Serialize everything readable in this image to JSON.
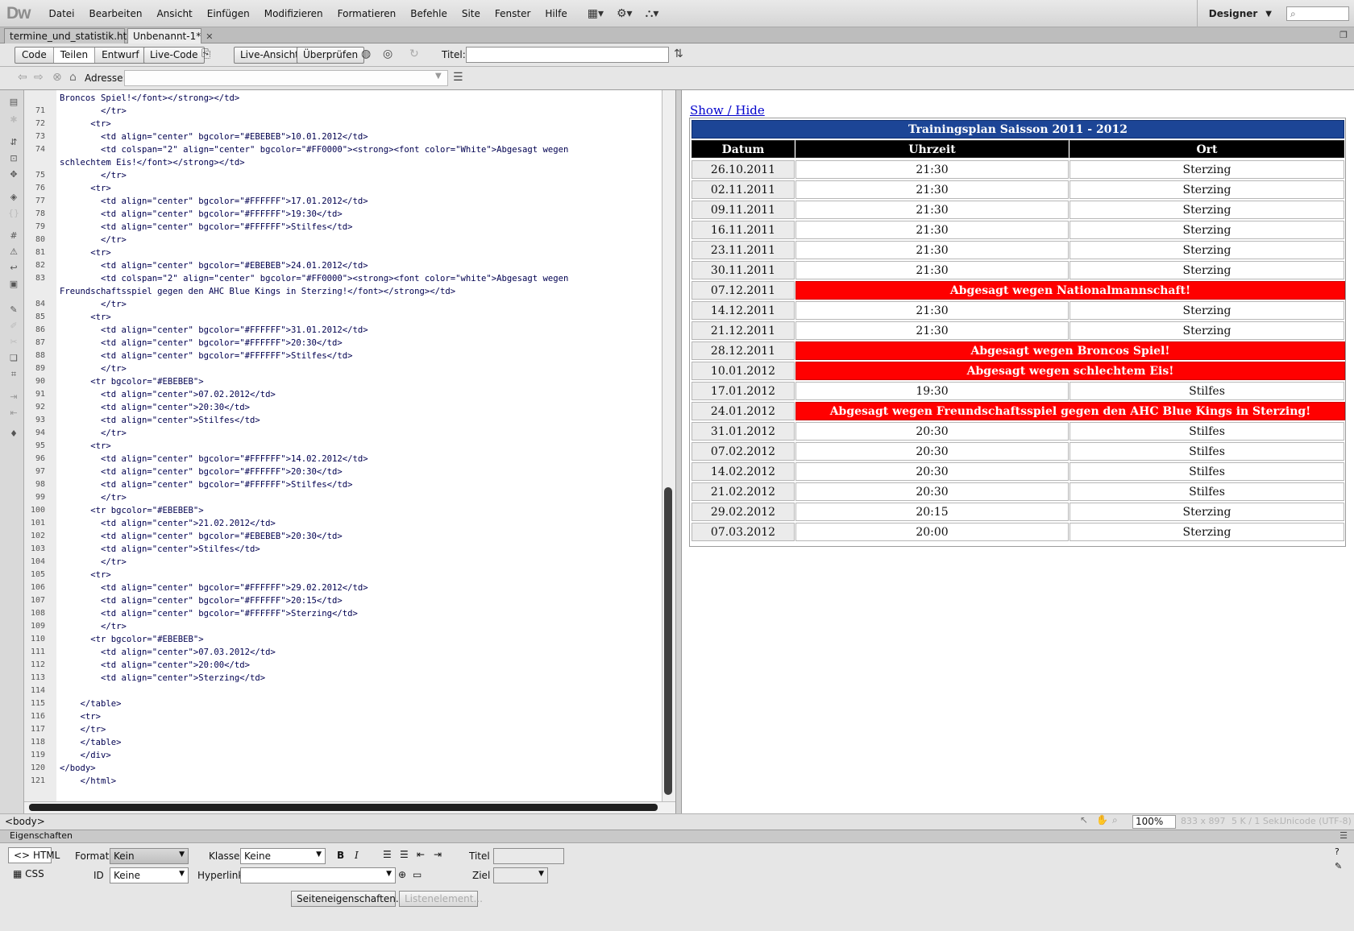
{
  "app": {
    "logo": "Dw",
    "menu": [
      "Datei",
      "Bearbeiten",
      "Ansicht",
      "Einfügen",
      "Modifizieren",
      "Formatieren",
      "Befehle",
      "Site",
      "Fenster",
      "Hilfe"
    ],
    "workspace": "Designer"
  },
  "tabs": [
    {
      "label": "termine_und_statistik.htm",
      "active": false
    },
    {
      "label": "Unbenannt-1*",
      "active": true
    }
  ],
  "toolbar": {
    "code": "Code",
    "split": "Teilen",
    "design": "Entwurf",
    "live_code": "Live-Code",
    "live_view": "Live-Ansicht",
    "check": "Überprüfen",
    "title_label": "Titel:",
    "title_value": ""
  },
  "address": {
    "label": "Adresse:",
    "value": ""
  },
  "code": {
    "lines": [
      {
        "num": "",
        "text": "Broncos Spiel!</font></strong></td>"
      },
      {
        "num": "71",
        "text": "        </tr>"
      },
      {
        "num": "72",
        "text": "      <tr>"
      },
      {
        "num": "73",
        "text": "        <td align=\"center\" bgcolor=\"#EBEBEB\">10.01.2012</td>"
      },
      {
        "num": "74",
        "text": "        <td colspan=\"2\" align=\"center\" bgcolor=\"#FF0000\"><strong><font color=\"White\">Abgesagt wegen"
      },
      {
        "num": "",
        "text": "schlechtem Eis!</font></strong></td>"
      },
      {
        "num": "75",
        "text": "        </tr>"
      },
      {
        "num": "76",
        "text": "      <tr>"
      },
      {
        "num": "77",
        "text": "        <td align=\"center\" bgcolor=\"#FFFFFF\">17.01.2012</td>"
      },
      {
        "num": "78",
        "text": "        <td align=\"center\" bgcolor=\"#FFFFFF\">19:30</td>"
      },
      {
        "num": "79",
        "text": "        <td align=\"center\" bgcolor=\"#FFFFFF\">Stilfes</td>"
      },
      {
        "num": "80",
        "text": "        </tr>"
      },
      {
        "num": "81",
        "text": "      <tr>"
      },
      {
        "num": "82",
        "text": "        <td align=\"center\" bgcolor=\"#EBEBEB\">24.01.2012</td>"
      },
      {
        "num": "83",
        "text": "        <td colspan=\"2\" align=\"center\" bgcolor=\"#FF0000\"><strong><font color=\"white\">Abgesagt wegen"
      },
      {
        "num": "",
        "text": "Freundschaftsspiel gegen den AHC Blue Kings in Sterzing!</font></strong></td>"
      },
      {
        "num": "84",
        "text": "        </tr>"
      },
      {
        "num": "85",
        "text": "      <tr>"
      },
      {
        "num": "86",
        "text": "        <td align=\"center\" bgcolor=\"#FFFFFF\">31.01.2012</td>"
      },
      {
        "num": "87",
        "text": "        <td align=\"center\" bgcolor=\"#FFFFFF\">20:30</td>"
      },
      {
        "num": "88",
        "text": "        <td align=\"center\" bgcolor=\"#FFFFFF\">Stilfes</td>"
      },
      {
        "num": "89",
        "text": "        </tr>"
      },
      {
        "num": "90",
        "text": "      <tr bgcolor=\"#EBEBEB\">"
      },
      {
        "num": "91",
        "text": "        <td align=\"center\">07.02.2012</td>"
      },
      {
        "num": "92",
        "text": "        <td align=\"center\">20:30</td>"
      },
      {
        "num": "93",
        "text": "        <td align=\"center\">Stilfes</td>"
      },
      {
        "num": "94",
        "text": "        </tr>"
      },
      {
        "num": "95",
        "text": "      <tr>"
      },
      {
        "num": "96",
        "text": "        <td align=\"center\" bgcolor=\"#FFFFFF\">14.02.2012</td>"
      },
      {
        "num": "97",
        "text": "        <td align=\"center\" bgcolor=\"#FFFFFF\">20:30</td>"
      },
      {
        "num": "98",
        "text": "        <td align=\"center\" bgcolor=\"#FFFFFF\">Stilfes</td>"
      },
      {
        "num": "99",
        "text": "        </tr>"
      },
      {
        "num": "100",
        "text": "      <tr bgcolor=\"#EBEBEB\">"
      },
      {
        "num": "101",
        "text": "        <td align=\"center\">21.02.2012</td>"
      },
      {
        "num": "102",
        "text": "        <td align=\"center\" bgcolor=\"#EBEBEB\">20:30</td>"
      },
      {
        "num": "103",
        "text": "        <td align=\"center\">Stilfes</td>"
      },
      {
        "num": "104",
        "text": "        </tr>"
      },
      {
        "num": "105",
        "text": "      <tr>"
      },
      {
        "num": "106",
        "text": "        <td align=\"center\" bgcolor=\"#FFFFFF\">29.02.2012</td>"
      },
      {
        "num": "107",
        "text": "        <td align=\"center\" bgcolor=\"#FFFFFF\">20:15</td>"
      },
      {
        "num": "108",
        "text": "        <td align=\"center\" bgcolor=\"#FFFFFF\">Sterzing</td>"
      },
      {
        "num": "109",
        "text": "        </tr>"
      },
      {
        "num": "110",
        "text": "      <tr bgcolor=\"#EBEBEB\">"
      },
      {
        "num": "111",
        "text": "        <td align=\"center\">07.03.2012</td>"
      },
      {
        "num": "112",
        "text": "        <td align=\"center\">20:00</td>"
      },
      {
        "num": "113",
        "text": "        <td align=\"center\">Sterzing</td>"
      },
      {
        "num": "114",
        "text": ""
      },
      {
        "num": "115",
        "text": "    </table>"
      },
      {
        "num": "116",
        "text": "    <tr>"
      },
      {
        "num": "117",
        "text": "    </tr>"
      },
      {
        "num": "118",
        "text": "    </table>"
      },
      {
        "num": "119",
        "text": "    </div>"
      },
      {
        "num": "120",
        "text": "</body>"
      },
      {
        "num": "121",
        "text": "    </html>"
      }
    ]
  },
  "design": {
    "link": "Show / Hide",
    "table_title": "Trainingsplan Saisson 2011 - 2012",
    "headers": [
      "Datum",
      "Uhrzeit",
      "Ort"
    ],
    "rows": [
      {
        "date": "26.10.2011",
        "time": "21:30",
        "place": "Sterzing"
      },
      {
        "date": "02.11.2011",
        "time": "21:30",
        "place": "Sterzing"
      },
      {
        "date": "09.11.2011",
        "time": "21:30",
        "place": "Sterzing"
      },
      {
        "date": "16.11.2011",
        "time": "21:30",
        "place": "Sterzing"
      },
      {
        "date": "23.11.2011",
        "time": "21:30",
        "place": "Sterzing"
      },
      {
        "date": "30.11.2011",
        "time": "21:30",
        "place": "Sterzing"
      },
      {
        "date": "07.12.2011",
        "cancel": "Abgesagt wegen Nationalmannschaft!"
      },
      {
        "date": "14.12.2011",
        "time": "21:30",
        "place": "Sterzing"
      },
      {
        "date": "21.12.2011",
        "time": "21:30",
        "place": "Sterzing"
      },
      {
        "date": "28.12.2011",
        "cancel": "Abgesagt wegen Broncos Spiel!"
      },
      {
        "date": "10.01.2012",
        "cancel": "Abgesagt wegen schlechtem Eis!"
      },
      {
        "date": "17.01.2012",
        "time": "19:30",
        "place": "Stilfes"
      },
      {
        "date": "24.01.2012",
        "cancel": "Abgesagt wegen Freundschaftsspiel gegen den AHC Blue Kings in Sterzing!"
      },
      {
        "date": "31.01.2012",
        "time": "20:30",
        "place": "Stilfes"
      },
      {
        "date": "07.02.2012",
        "time": "20:30",
        "place": "Stilfes"
      },
      {
        "date": "14.02.2012",
        "time": "20:30",
        "place": "Stilfes"
      },
      {
        "date": "21.02.2012",
        "time": "20:30",
        "place": "Stilfes"
      },
      {
        "date": "29.02.2012",
        "time": "20:15",
        "place": "Sterzing"
      },
      {
        "date": "07.03.2012",
        "time": "20:00",
        "place": "Sterzing"
      }
    ]
  },
  "status": {
    "tag": "<body>",
    "zoom": "100%",
    "size": "833 x 897",
    "filesize": "5 K / 1 Sek.",
    "encoding": "Unicode (UTF-8)"
  },
  "properties": {
    "title": "Eigenschaften",
    "html_btn": "HTML",
    "css_btn": "CSS",
    "format_label": "Format",
    "format_value": "Kein",
    "id_label": "ID",
    "id_value": "Keine",
    "class_label": "Klasse",
    "class_value": "Keine",
    "hyperlink_label": "Hyperlink",
    "hyperlink_value": "",
    "titel_label": "Titel",
    "ziel_label": "Ziel",
    "page_props_btn": "Seiteneigenschaften...",
    "list_item_btn": "Listenelement..."
  },
  "colors": {
    "table_title_bg": "#1c4596",
    "cancel_bg": "#ff0000",
    "header_bg": "#000000",
    "date_bg": "#ebebeb"
  }
}
